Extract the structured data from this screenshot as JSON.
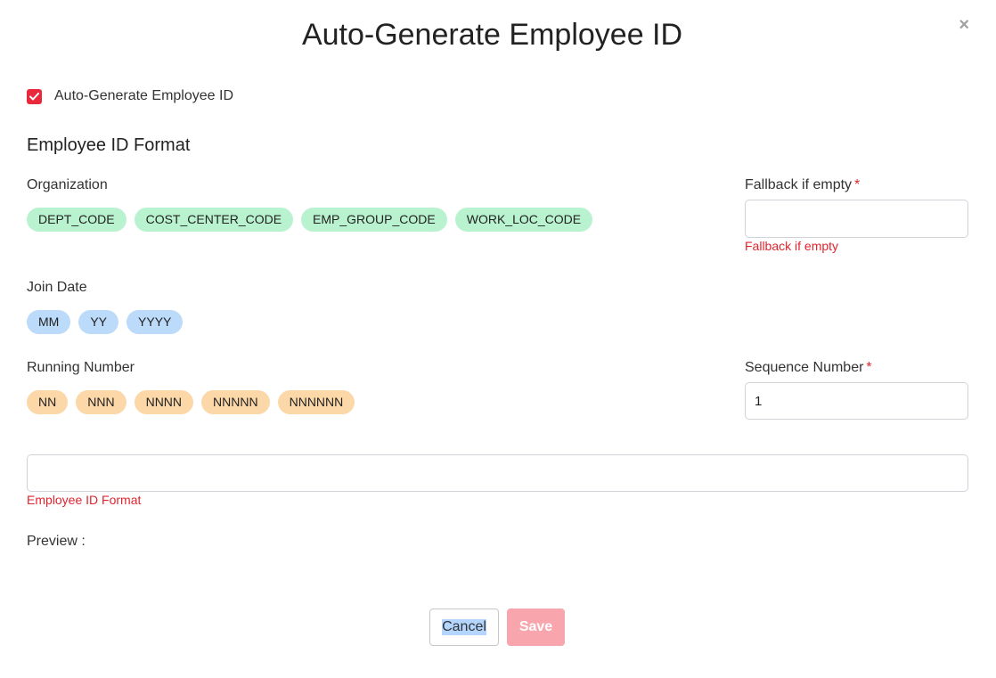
{
  "modal": {
    "title": "Auto-Generate Employee ID",
    "close_glyph": "×"
  },
  "auto_generate": {
    "label": "Auto-Generate Employee ID",
    "checked": true
  },
  "format": {
    "section_title": "Employee ID Format",
    "organization": {
      "label": "Organization",
      "chips": [
        "DEPT_CODE",
        "COST_CENTER_CODE",
        "EMP_GROUP_CODE",
        "WORK_LOC_CODE"
      ]
    },
    "join_date": {
      "label": "Join Date",
      "chips": [
        "MM",
        "YY",
        "YYYY"
      ]
    },
    "running_number": {
      "label": "Running Number",
      "chips": [
        "NN",
        "NNN",
        "NNNN",
        "NNNNN",
        "NNNNNN"
      ]
    },
    "fallback": {
      "label": "Fallback if empty",
      "required_mark": "*",
      "value": "",
      "error": "Fallback if empty"
    },
    "sequence": {
      "label": "Sequence Number",
      "required_mark": "*",
      "value": "1"
    },
    "format_input": {
      "value": "",
      "error": "Employee ID Format"
    },
    "preview_label": "Preview :"
  },
  "buttons": {
    "cancel": "Cancel",
    "save": "Save"
  },
  "colors": {
    "accent_red": "#e8293c",
    "chip_green": "#b9f2cf",
    "chip_blue": "#bcdaf9",
    "chip_orange": "#fcd7a8",
    "save_disabled": "#f9a5ad"
  },
  "icons": {
    "close": "close-icon",
    "checkbox": "checkmark-icon"
  }
}
